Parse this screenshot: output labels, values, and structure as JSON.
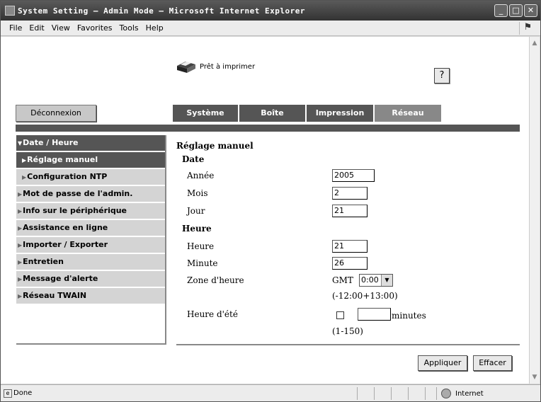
{
  "window": {
    "title": "System Setting – Admin Mode – Microsoft Internet Explorer",
    "buttons": {
      "minimize": "_",
      "maximize": "□",
      "close": "✕"
    }
  },
  "menubar": {
    "items": [
      "File",
      "Edit",
      "View",
      "Favorites",
      "Tools",
      "Help"
    ]
  },
  "header": {
    "status_text": "Prêt à imprimer",
    "help_label": "?",
    "logout_label": "Déconnexion"
  },
  "tabs": [
    {
      "label": "Système"
    },
    {
      "label": "Boîte"
    },
    {
      "label": "Impression"
    },
    {
      "label": "Réseau"
    }
  ],
  "sidebar": {
    "items": [
      {
        "label": "Date / Heure",
        "marker": "▼"
      },
      {
        "label": "Réglage manuel",
        "marker": "▶"
      },
      {
        "label": "Configuration NTP",
        "marker": "▶"
      },
      {
        "label": "Mot de passe de l'admin.",
        "marker": "▶"
      },
      {
        "label": "Info sur le périphérique",
        "marker": "▶"
      },
      {
        "label": "Assistance en ligne",
        "marker": "▶"
      },
      {
        "label": "Importer / Exporter",
        "marker": "▶"
      },
      {
        "label": "Entretien",
        "marker": "▶"
      },
      {
        "label": "Message d'alerte",
        "marker": "▶"
      },
      {
        "label": "Réseau TWAIN",
        "marker": "▶"
      }
    ]
  },
  "form": {
    "title": "Réglage manuel",
    "date_section": "Date",
    "year_label": "Année",
    "year_value": "2005",
    "month_label": "Mois",
    "month_value": "2",
    "day_label": "Jour",
    "day_value": "21",
    "time_section": "Heure",
    "hour_label": "Heure",
    "hour_value": "21",
    "minute_label": "Minute",
    "minute_value": "26",
    "zone_label": "Zone d'heure",
    "zone_prefix": "GMT",
    "zone_value": "0:00",
    "zone_range": "(-12:00+13:00)",
    "dst_label": "Heure d'été",
    "dst_minutes_value": "",
    "dst_unit": "minutes",
    "dst_range": "(1-150)",
    "apply_label": "Appliquer",
    "clear_label": "Effacer"
  },
  "statusbar": {
    "done_text": "Done",
    "zone_text": "Internet"
  }
}
